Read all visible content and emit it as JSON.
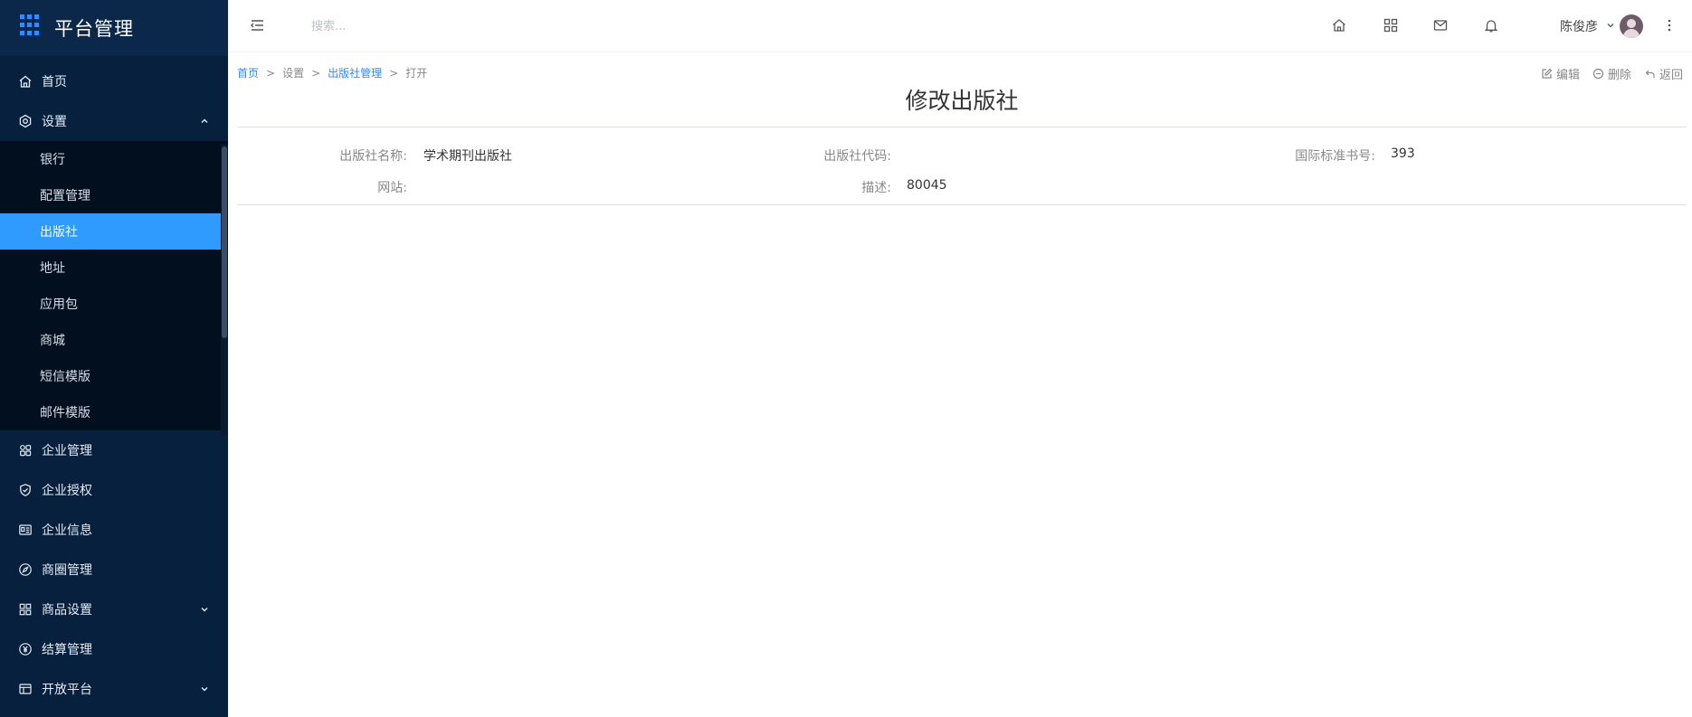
{
  "app": {
    "title": "平台管理"
  },
  "sidebar": {
    "items": [
      {
        "label": "首页",
        "icon": "home-icon"
      },
      {
        "label": "设置",
        "icon": "settings-icon",
        "expanded": true,
        "children": [
          {
            "label": "银行"
          },
          {
            "label": "配置管理"
          },
          {
            "label": "出版社",
            "active": true
          },
          {
            "label": "地址"
          },
          {
            "label": "应用包"
          },
          {
            "label": "商城"
          },
          {
            "label": "短信模版"
          },
          {
            "label": "邮件模版"
          }
        ]
      },
      {
        "label": "企业管理",
        "icon": "enterprise-icon"
      },
      {
        "label": "企业授权",
        "icon": "shield-check-icon"
      },
      {
        "label": "企业信息",
        "icon": "id-card-icon"
      },
      {
        "label": "商圈管理",
        "icon": "compass-icon"
      },
      {
        "label": "商品设置",
        "icon": "grid-icon",
        "has_children": true
      },
      {
        "label": "结算管理",
        "icon": "yen-circle-icon"
      },
      {
        "label": "开放平台",
        "icon": "table-icon",
        "has_children": true
      }
    ],
    "accent_color": "#2f9bff",
    "bg_color": "#06203d"
  },
  "topbar": {
    "search_placeholder": "搜索...",
    "icons": [
      "home-icon",
      "apps-icon",
      "mail-icon",
      "bell-icon"
    ],
    "user_name": "陈俊彦"
  },
  "breadcrumb": {
    "items": [
      "首页",
      "设置",
      "出版社管理",
      "打开"
    ],
    "separator": ">"
  },
  "actions": {
    "edit": "编辑",
    "delete": "删除",
    "back": "返回"
  },
  "page": {
    "title": "修改出版社",
    "fields": {
      "name_label": "出版社名称:",
      "name_value": "学术期刊出版社",
      "code_label": "出版社代码:",
      "code_value": "",
      "isbn_label": "国际标准书号:",
      "isbn_value": "393",
      "site_label": "网站:",
      "site_value": "",
      "desc_label": "描述:",
      "desc_value": "80045"
    }
  }
}
